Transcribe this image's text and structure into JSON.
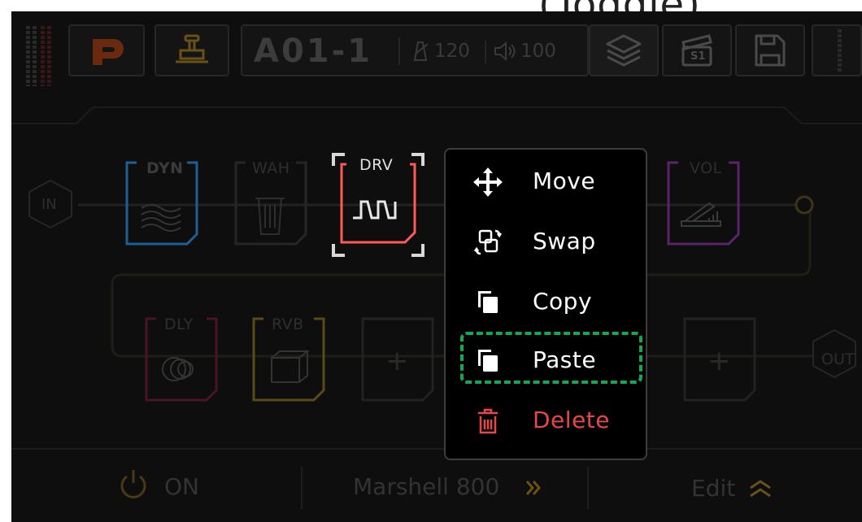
{
  "header": {
    "caption": "(Toggle)"
  },
  "topbar": {
    "preset_name": "A01-1",
    "tempo": "120",
    "volume": "100",
    "scene_label": "S1"
  },
  "chain": {
    "input_label": "IN",
    "output_label": "OUT",
    "row1": [
      {
        "label": "DYN",
        "color": "#1f5f93"
      },
      {
        "label": "WAH",
        "color": "#3a3a3a"
      },
      {
        "label": "DRV",
        "color": "#ff5a57"
      },
      {
        "label": "VOL",
        "color": "#5a2468"
      }
    ],
    "row2": [
      {
        "label": "DLY",
        "color": "#5a1a2a"
      },
      {
        "label": "RVB",
        "color": "#6b5a1e"
      },
      {
        "label": "+"
      },
      {
        "label": "+"
      }
    ]
  },
  "context_menu": {
    "items": [
      {
        "label": "Move",
        "icon": "move-icon"
      },
      {
        "label": "Swap",
        "icon": "swap-icon"
      },
      {
        "label": "Copy",
        "icon": "copy-icon"
      },
      {
        "label": "Paste",
        "icon": "paste-icon",
        "highlighted": true,
        "highlight_color": "#1aa551"
      },
      {
        "label": "Delete",
        "icon": "trash-icon",
        "color": "#e6484a"
      }
    ]
  },
  "bottombar": {
    "power_label": "ON",
    "amp_model": "Marshell 800",
    "edit_label": "Edit"
  }
}
